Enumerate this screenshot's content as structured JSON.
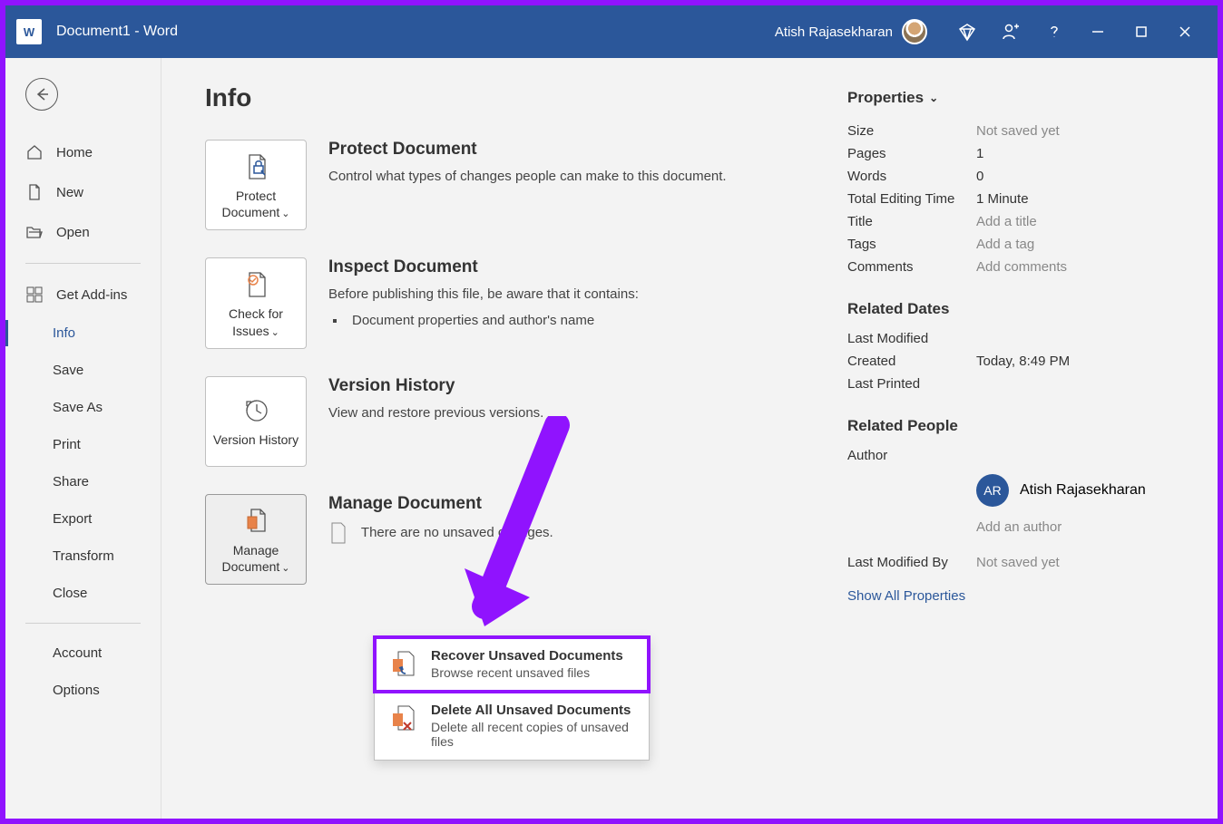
{
  "titlebar": {
    "logo_text": "W",
    "title": "Document1  -  Word",
    "user_name": "Atish Rajasekharan"
  },
  "sidebar": {
    "home": "Home",
    "new": "New",
    "open": "Open",
    "addins": "Get Add-ins",
    "info": "Info",
    "save": "Save",
    "saveas": "Save As",
    "print": "Print",
    "share": "Share",
    "export": "Export",
    "transform": "Transform",
    "close": "Close",
    "account": "Account",
    "options": "Options"
  },
  "page": {
    "heading": "Info",
    "protect": {
      "card": "Protect Document",
      "title": "Protect Document",
      "desc": "Control what types of changes people can make to this document."
    },
    "inspect": {
      "card": "Check for Issues",
      "title": "Inspect Document",
      "desc": "Before publishing this file, be aware that it contains:",
      "item1": "Document properties and author's name"
    },
    "history": {
      "card": "Version History",
      "title": "Version History",
      "desc": "View and restore previous versions."
    },
    "manage": {
      "card": "Manage Document",
      "title": "Manage Document",
      "desc": "There are no unsaved changes."
    },
    "dropdown": {
      "recover_title": "Recover Unsaved Documents",
      "recover_sub": "Browse recent unsaved files",
      "delete_title": "Delete All Unsaved Documents",
      "delete_sub": "Delete all recent copies of unsaved files"
    }
  },
  "props": {
    "header": "Properties",
    "size_label": "Size",
    "size_value": "Not saved yet",
    "pages_label": "Pages",
    "pages_value": "1",
    "words_label": "Words",
    "words_value": "0",
    "time_label": "Total Editing Time",
    "time_value": "1 Minute",
    "title_label": "Title",
    "title_value": "Add a title",
    "tags_label": "Tags",
    "tags_value": "Add a tag",
    "comments_label": "Comments",
    "comments_value": "Add comments",
    "dates_header": "Related Dates",
    "modified_label": "Last Modified",
    "created_label": "Created",
    "created_value": "Today, 8:49 PM",
    "printed_label": "Last Printed",
    "people_header": "Related People",
    "author_label": "Author",
    "author_initials": "AR",
    "author_name": "Atish Rajasekharan",
    "add_author": "Add an author",
    "lastmodby_label": "Last Modified By",
    "lastmodby_value": "Not saved yet",
    "show_all": "Show All Properties"
  }
}
